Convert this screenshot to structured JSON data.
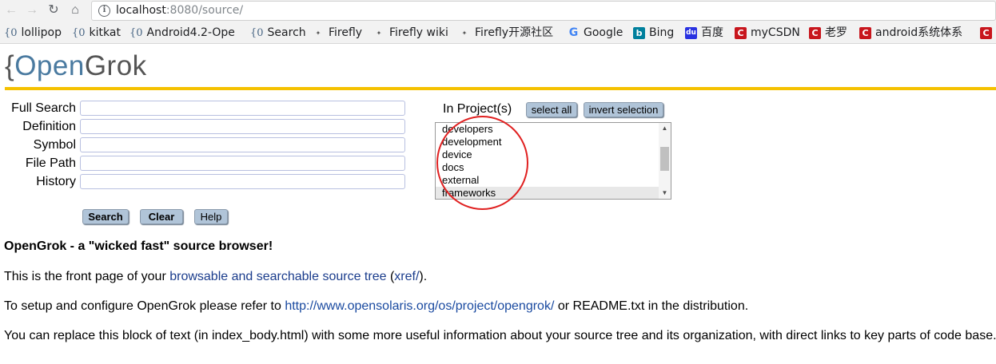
{
  "browser": {
    "url_host": "localhost",
    "url_rest": ":8080/source/",
    "bookmarks": [
      {
        "label": "lollipop",
        "icon": "opengrok-icon"
      },
      {
        "label": "kitkat",
        "icon": "opengrok-icon"
      },
      {
        "label": "Android4.2-Ope",
        "icon": "opengrok-icon"
      },
      {
        "label": "Search",
        "icon": "opengrok-icon"
      },
      {
        "label": "Firefly",
        "icon": "firefly-icon"
      },
      {
        "label": "Firefly wiki",
        "icon": "firefly-icon"
      },
      {
        "label": "Firefly开源社区",
        "icon": "firefly-icon"
      },
      {
        "label": "Google",
        "icon": "google-icon"
      },
      {
        "label": "Bing",
        "icon": "bing-icon"
      },
      {
        "label": "百度",
        "icon": "baidu-icon"
      },
      {
        "label": "myCSDN",
        "icon": "csdn-icon"
      },
      {
        "label": "老罗",
        "icon": "csdn-icon"
      },
      {
        "label": "android系统体系",
        "icon": "csdn-icon"
      }
    ]
  },
  "logo": {
    "brace": "{",
    "open": "Open",
    "grok": "Grok"
  },
  "search": {
    "fields": [
      {
        "label": "Full Search",
        "value": ""
      },
      {
        "label": "Definition",
        "value": ""
      },
      {
        "label": "Symbol",
        "value": ""
      },
      {
        "label": "File Path",
        "value": ""
      },
      {
        "label": "History",
        "value": ""
      }
    ],
    "buttons": {
      "search": "Search",
      "clear": "Clear",
      "help": "Help"
    }
  },
  "projects": {
    "label": "In Project(s)",
    "select_all": "select all",
    "invert_selection": "invert selection",
    "items": [
      "developers",
      "development",
      "device",
      "docs",
      "external",
      "frameworks"
    ],
    "selected": "frameworks"
  },
  "content": {
    "tagline": "OpenGrok - a \"wicked fast\" source browser!",
    "p1_pre": "This is the front page of your ",
    "p1_link": "browsable and searchable source tree",
    "p1_mid": " (",
    "p1_link2": "xref/",
    "p1_post": ").",
    "p2_pre": "To setup and configure OpenGrok please refer to ",
    "p2_link": "http://www.opensolaris.org/os/project/opengrok/",
    "p2_post": " or README.txt in the distribution.",
    "p3": "You can replace this block of text (in index_body.html) with some more useful information about your source tree and its organization, with direct links to key parts of code base."
  },
  "colors": {
    "accent_rule": "#f5c100",
    "annotation": "#e02020",
    "link": "#1a3c8c"
  }
}
